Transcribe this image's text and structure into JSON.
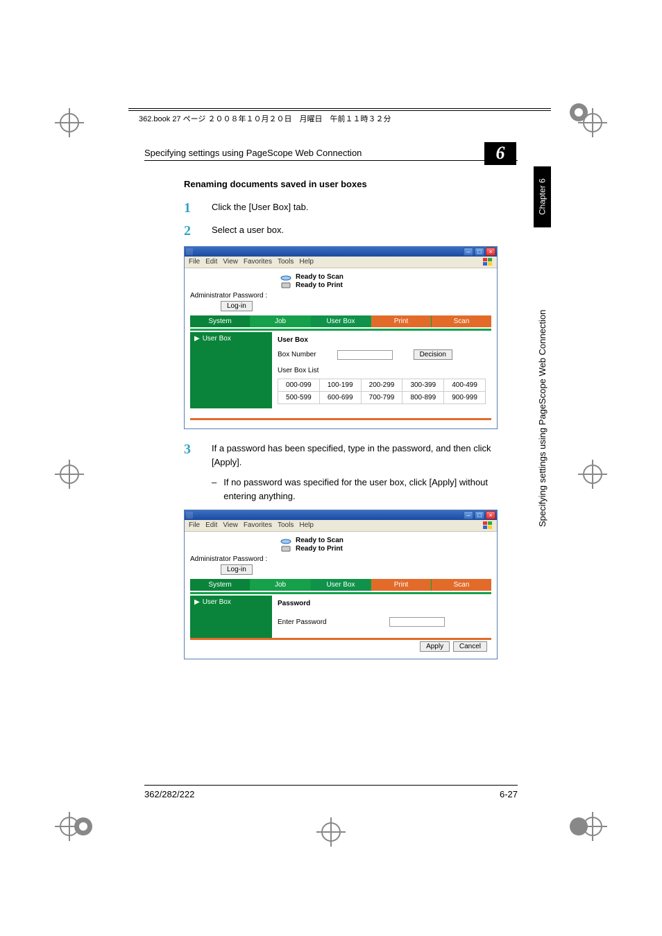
{
  "print_header": "362.book  27 ページ  ２００８年１０月２０日　月曜日　午前１１時３２分",
  "running": {
    "title": "Specifying settings using PageScope Web Connection",
    "chapter_number": "6",
    "side_tab": "Chapter 6",
    "side_title": "Specifying settings using PageScope Web Connection"
  },
  "section_title": "Renaming documents saved in user boxes",
  "steps": {
    "1": {
      "num": "1",
      "text": "Click the [User Box] tab."
    },
    "2": {
      "num": "2",
      "text": "Select a user box."
    },
    "3": {
      "num": "3",
      "text": "If a password has been specified, type in the password, and then click [Apply].",
      "sub_dash": "–",
      "sub": "If no password was specified for the user box, click [Apply] without entering anything."
    }
  },
  "browser": {
    "menubar": [
      "File",
      "Edit",
      "View",
      "Favorites",
      "Tools",
      "Help"
    ],
    "status_scan": "Ready to Scan",
    "status_print": "Ready to Print",
    "admin_label": "Administrator Password :",
    "login_btn": "Log-in",
    "tabs": {
      "system": "System",
      "job": "Job",
      "userbox": "User Box",
      "print": "Print",
      "scan": "Scan"
    },
    "sidebar_item": "User Box"
  },
  "screenshot1": {
    "panel_title": "User Box",
    "box_number_label": "Box Number",
    "decision_btn": "Decision",
    "list_label": "User Box List",
    "ranges": [
      [
        "000-099",
        "100-199",
        "200-299",
        "300-399",
        "400-499"
      ],
      [
        "500-599",
        "600-699",
        "700-799",
        "800-899",
        "900-999"
      ]
    ]
  },
  "screenshot2": {
    "panel_title": "Password",
    "enter_pwd_label": "Enter Password",
    "apply_btn": "Apply",
    "cancel_btn": "Cancel"
  },
  "footer": {
    "left": "362/282/222",
    "right": "6-27"
  }
}
